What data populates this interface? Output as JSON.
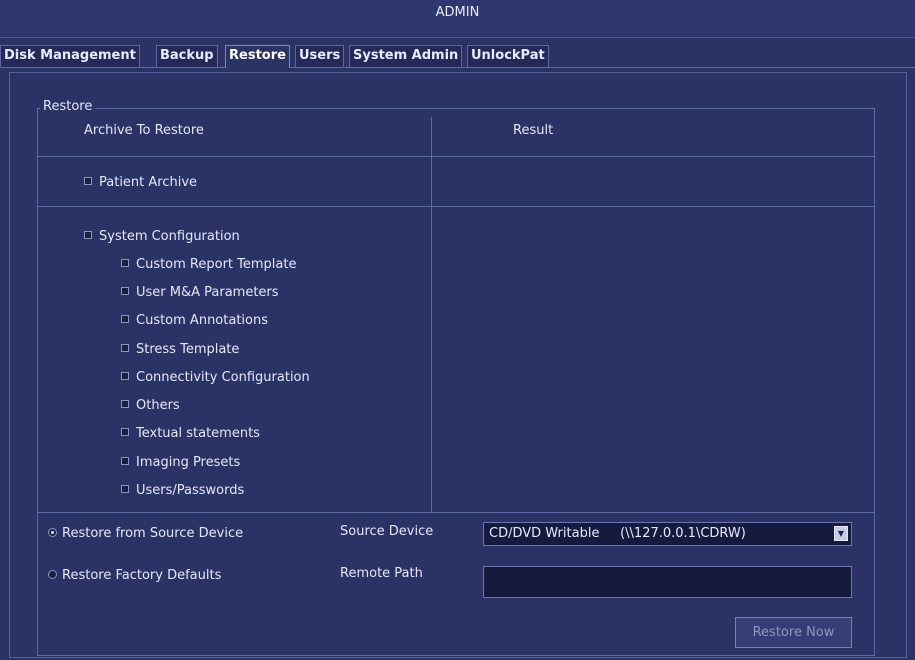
{
  "window": {
    "title": "ADMIN"
  },
  "tabs": [
    {
      "label": "Disk Management"
    },
    {
      "label": "Backup"
    },
    {
      "label": "Restore"
    },
    {
      "label": "Users"
    },
    {
      "label": "System Admin"
    },
    {
      "label": "UnlockPat"
    }
  ],
  "active_tab": "Restore",
  "restore": {
    "group_label": "Restore",
    "col_archive": "Archive To Restore",
    "col_result": "Result",
    "patient_archive": {
      "label": "Patient Archive",
      "checked": false
    },
    "system_configuration": {
      "label": "System Configuration",
      "checked": false
    },
    "config_items": [
      {
        "label": "Custom Report Template",
        "checked": false
      },
      {
        "label": "User M&A Parameters",
        "checked": false
      },
      {
        "label": "Custom Annotations",
        "checked": false
      },
      {
        "label": "Stress Template",
        "checked": false
      },
      {
        "label": "Connectivity Configuration",
        "checked": false
      },
      {
        "label": "Others",
        "checked": false
      },
      {
        "label": "Textual statements",
        "checked": false
      },
      {
        "label": "Imaging Presets",
        "checked": false
      },
      {
        "label": "Users/Passwords",
        "checked": false
      }
    ],
    "options": {
      "from_source": {
        "label": "Restore from Source Device",
        "selected": true
      },
      "factory_defaults": {
        "label": "Restore Factory Defaults",
        "selected": false
      }
    },
    "source_device_label": "Source Device",
    "source_device_value": "CD/DVD Writable     (\\\\127.0.0.1\\CDRW)",
    "remote_path_label": "Remote Path",
    "remote_path_value": "",
    "restore_now": "Restore Now"
  },
  "colors": {
    "background": "#2b3366",
    "border": "#5e6aa4",
    "text": "#e4e8f6",
    "field": "#151a3e",
    "disabled_text": "#8d97c4"
  }
}
